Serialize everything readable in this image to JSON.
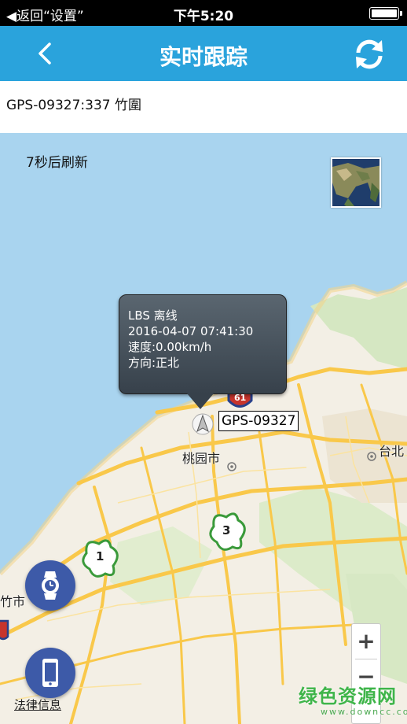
{
  "status_bar": {
    "back_text": "◀返回“设置”",
    "time": "下午5:20"
  },
  "nav": {
    "title": "实时跟踪"
  },
  "device_bar": {
    "text": "GPS-09327:337 竹圍"
  },
  "map": {
    "countdown": "7秒后刷新",
    "callout": {
      "status": "LBS 离线",
      "timestamp": "2016-04-07 07:41:30",
      "speed": "速度:0.00km/h",
      "direction": "方向:正北"
    },
    "device_label": "GPS-09327",
    "places": {
      "taoyuan": "桃园市",
      "taipei": "台北",
      "hsinchu": "竹市"
    },
    "road_shields": {
      "r61": "61",
      "r3": "3",
      "r1": "1"
    },
    "zoom_in": "+",
    "zoom_out": "−",
    "legal": "法律信息",
    "watermark": "绿色资源网",
    "watermark_url": "www.downcc.com"
  },
  "colors": {
    "nav_bg": "#2aa3dc",
    "fab_bg": "#3d5aa8",
    "sea": "#a9d4ef",
    "land": "#f3efe5",
    "road": "#f9c84a"
  },
  "icons": {
    "back": "chevron-left-icon",
    "refresh": "refresh-icon",
    "watch": "watch-icon",
    "phone": "phone-icon",
    "pin": "navigation-arrow-icon"
  }
}
